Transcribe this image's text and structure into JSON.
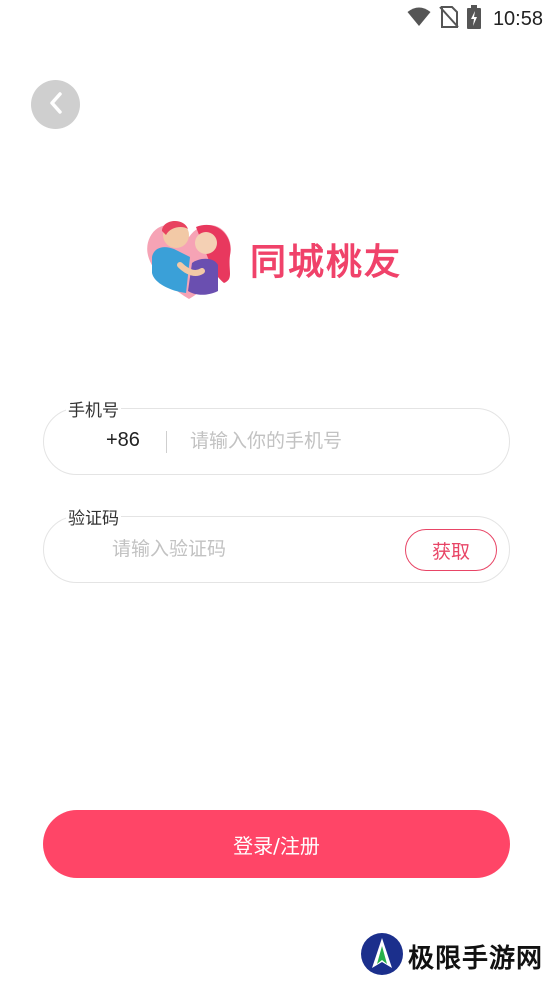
{
  "status_bar": {
    "time": "10:58",
    "icons": [
      "wifi-icon",
      "no-sim-icon",
      "battery-charging-icon"
    ]
  },
  "header": {
    "back_icon": "chevron-left-icon"
  },
  "logo": {
    "app_name": "同城桃友",
    "brand_color": "#f0426a"
  },
  "phone_field": {
    "label": "手机号",
    "country_code": "+86",
    "placeholder": "请输入你的手机号",
    "value": ""
  },
  "code_field": {
    "label": "验证码",
    "placeholder": "请输入验证码",
    "value": "",
    "get_code_label": "获取"
  },
  "login_button": {
    "label": "登录/注册",
    "color": "#ff4567"
  },
  "watermark": {
    "text": "极限手游网"
  }
}
